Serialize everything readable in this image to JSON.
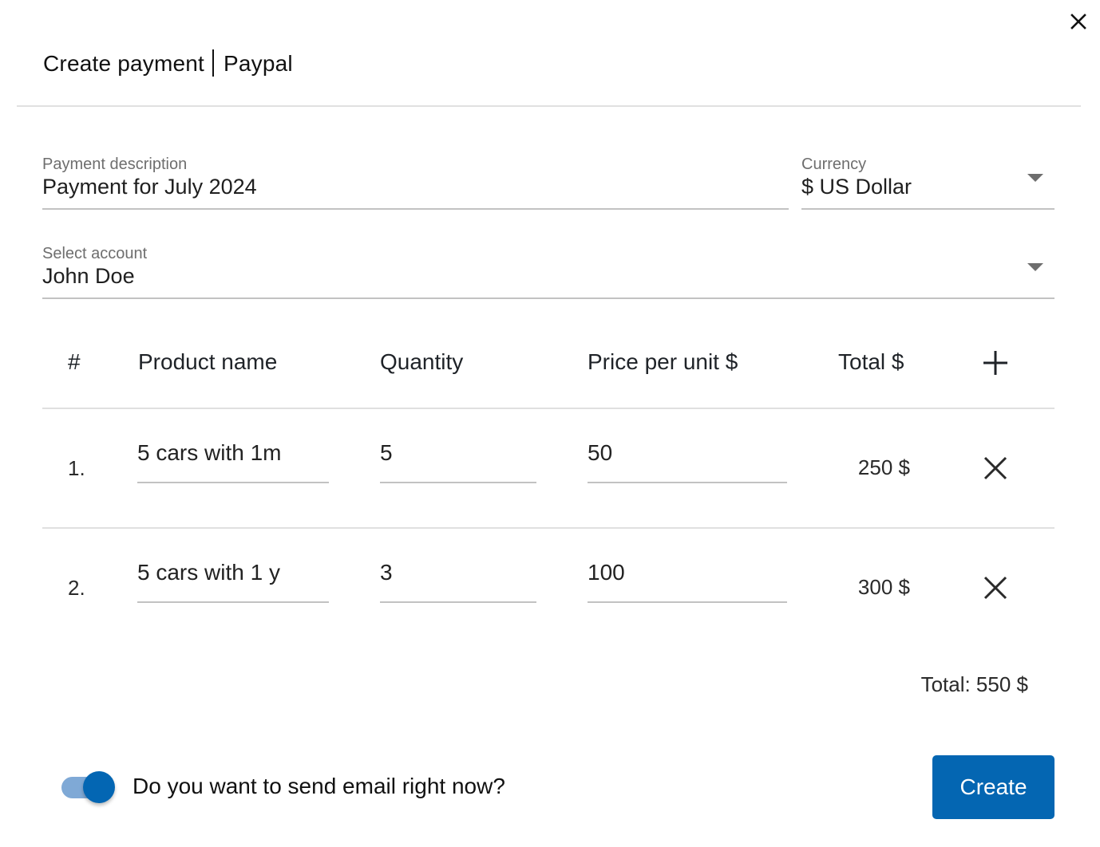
{
  "dialog": {
    "title_left": "Create payment",
    "title_right": "Paypal",
    "close_icon": "close-icon"
  },
  "form": {
    "description": {
      "label": "Payment description",
      "value": "Payment for July 2024"
    },
    "currency": {
      "label": "Currency",
      "value": "$ US Dollar"
    },
    "account": {
      "label": "Select account",
      "value": "John Doe"
    }
  },
  "table": {
    "headers": {
      "index": "#",
      "product": "Product name",
      "quantity": "Quantity",
      "price": "Price per unit $",
      "total": "Total $",
      "add_icon": "plus-icon"
    },
    "rows": [
      {
        "index": "1.",
        "product": "5 cars with 1m",
        "quantity": "5",
        "price": "50",
        "total": "250 $"
      },
      {
        "index": "2.",
        "product": "5 cars with 1 y",
        "quantity": "3",
        "price": "100",
        "total": "300 $"
      }
    ]
  },
  "summary": {
    "total": "Total: 550 $"
  },
  "footer": {
    "send_email": {
      "label": "Do you want to send email right now?",
      "checked": true
    },
    "create_label": "Create"
  },
  "colors": {
    "primary": "#0466b2",
    "toggle_track": "#7fa9d6",
    "divider": "#e0e0e0",
    "underline": "#c2c2c2"
  }
}
